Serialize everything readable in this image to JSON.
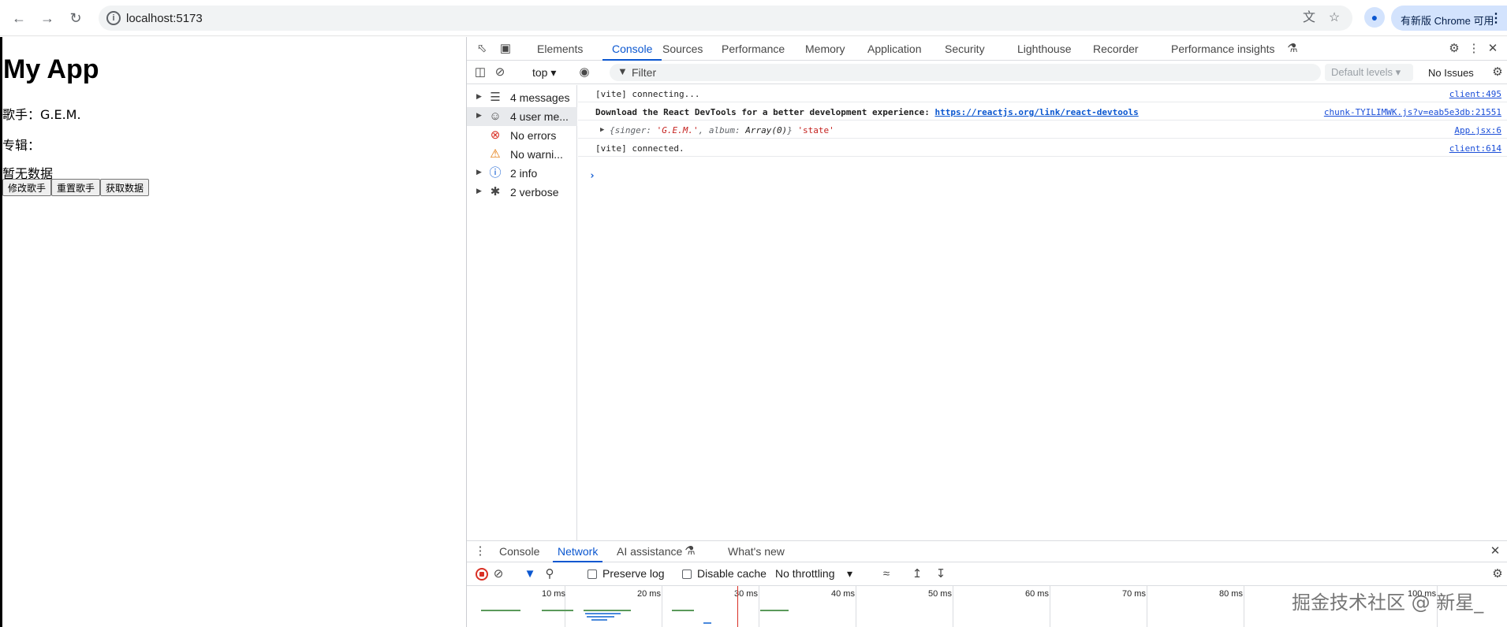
{
  "browser": {
    "url": "localhost:5173",
    "update_label": "有新版 Chrome 可用"
  },
  "page": {
    "title": "My App",
    "singer_line": "歌手：G.E.M.",
    "album_line": "专辑：",
    "empty_text": "暂无数据",
    "buttons": [
      "修改歌手",
      "重置歌手",
      "获取数据"
    ]
  },
  "devtools": {
    "tabs": [
      "Elements",
      "Console",
      "Sources",
      "Performance",
      "Memory",
      "Application",
      "Security",
      "Lighthouse",
      "Recorder",
      "Performance insights"
    ],
    "active_tab": "Console",
    "context": "top",
    "filter_placeholder": "Filter",
    "levels": "Default levels",
    "issues": "No Issues",
    "sidebar": [
      {
        "label": "4 messages",
        "icon": "list-icon"
      },
      {
        "label": "4 user me...",
        "icon": "user-icon"
      },
      {
        "label": "No errors",
        "icon": "error-icon"
      },
      {
        "label": "No warni...",
        "icon": "warning-icon"
      },
      {
        "label": "2 info",
        "icon": "info-icon"
      },
      {
        "label": "2 verbose",
        "icon": "bug-icon"
      }
    ],
    "logs": [
      {
        "message": "[vite] connecting...",
        "source": "client:495"
      },
      {
        "message_prefix": "Download the React DevTools for a better development experience: ",
        "link": "https://reactjs.org/link/react-devtools",
        "source": "chunk-TYILIMWK.js?v=eab5e3db:21551"
      },
      {
        "obj_open": "{singer: ",
        "obj_singer": "'G.E.M.'",
        "obj_mid": ", album: ",
        "obj_album": "Array(0)",
        "obj_close": "}",
        "obj_state": "'state'",
        "source": "App.jsx:6"
      },
      {
        "message": "[vite] connected.",
        "source": "client:614"
      }
    ],
    "drawer_tabs": [
      "Console",
      "Network",
      "AI assistance",
      "What's new"
    ],
    "drawer_active": "Network",
    "network": {
      "preserve_log": "Preserve log",
      "disable_cache": "Disable cache",
      "throttling": "No throttling"
    },
    "timeline_ticks": [
      "10 ms",
      "20 ms",
      "30 ms",
      "40 ms",
      "50 ms",
      "60 ms",
      "70 ms",
      "80 ms",
      "100 ms"
    ]
  },
  "watermark": "掘金技术社区 @ 新星_"
}
